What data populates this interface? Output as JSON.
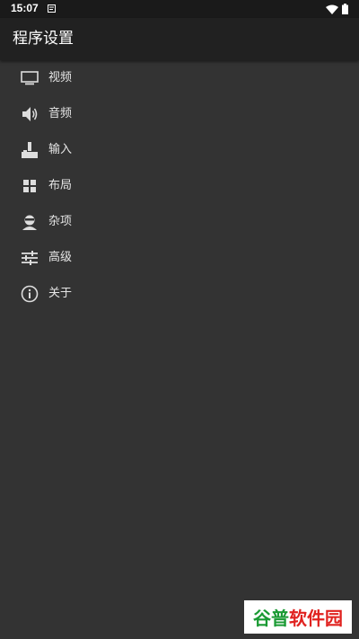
{
  "status_bar": {
    "time": "15:07"
  },
  "app_bar": {
    "title": "程序设置"
  },
  "menu": {
    "items": [
      {
        "label": "视频",
        "icon": "monitor-icon"
      },
      {
        "label": "音频",
        "icon": "speaker-icon"
      },
      {
        "label": "输入",
        "icon": "joystick-icon"
      },
      {
        "label": "布局",
        "icon": "grid-icon"
      },
      {
        "label": "杂项",
        "icon": "person-icon"
      },
      {
        "label": "高级",
        "icon": "sliders-icon"
      },
      {
        "label": "关于",
        "icon": "info-icon"
      }
    ]
  },
  "watermark": {
    "part1": "谷普",
    "part2": "软件园"
  },
  "colors": {
    "background": "#333333",
    "app_bar": "#212121",
    "status_bar": "#1a1a1a",
    "text": "#e6e6e6",
    "watermark_green": "#1a9a33",
    "watermark_red": "#e0221f"
  }
}
